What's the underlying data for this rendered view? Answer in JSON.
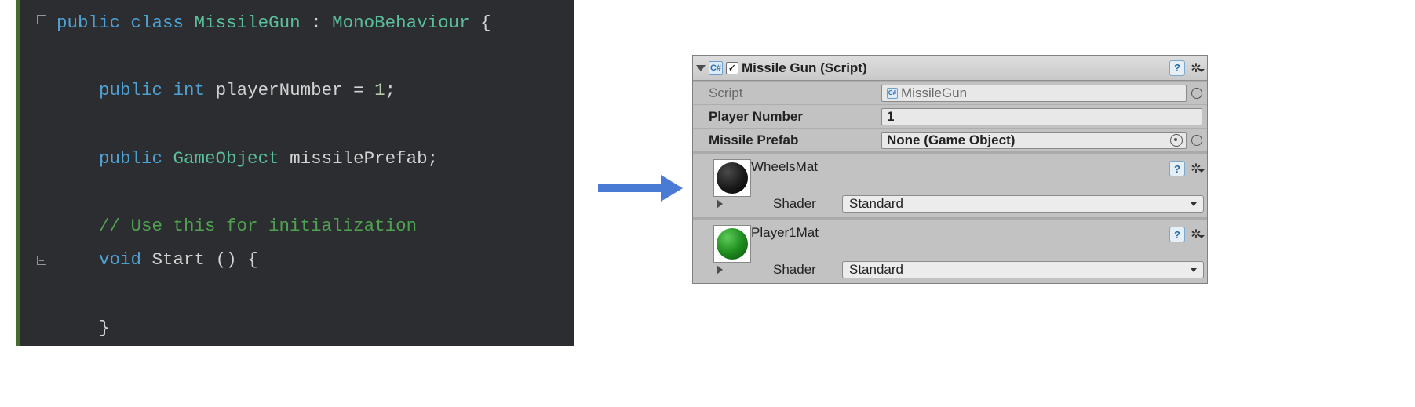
{
  "code": {
    "kw_public": "public",
    "kw_class": "class",
    "class_name": "MissileGun",
    "colon": " : ",
    "base_type": "MonoBehaviour",
    "brace_open": " {",
    "kw_int": "int",
    "field1_name": "playerNumber",
    "eq": " = ",
    "field1_val": "1",
    "semi": ";",
    "type_go": "GameObject",
    "field2_name": "missilePrefab",
    "comment": "// Use this for initialization",
    "kw_void": "void",
    "method_start": "Start",
    "parens": " () {",
    "brace_close": "}"
  },
  "inspector": {
    "comp_icon_text": "C#",
    "checkbox_mark": "✓",
    "comp_title": "Missile Gun (Script)",
    "help_glyph": "?",
    "gear_glyph": "✲",
    "script_label": "Script",
    "script_value": "MissileGun",
    "player_number_label": "Player Number",
    "player_number_value": "1",
    "missile_prefab_label": "Missile Prefab",
    "missile_prefab_value": "None (Game Object)",
    "materials": [
      {
        "name": "WheelsMat",
        "shader_label": "Shader",
        "shader_value": "Standard",
        "color": "dark"
      },
      {
        "name": "Player1Mat",
        "shader_label": "Shader",
        "shader_value": "Standard",
        "color": "green"
      }
    ]
  }
}
